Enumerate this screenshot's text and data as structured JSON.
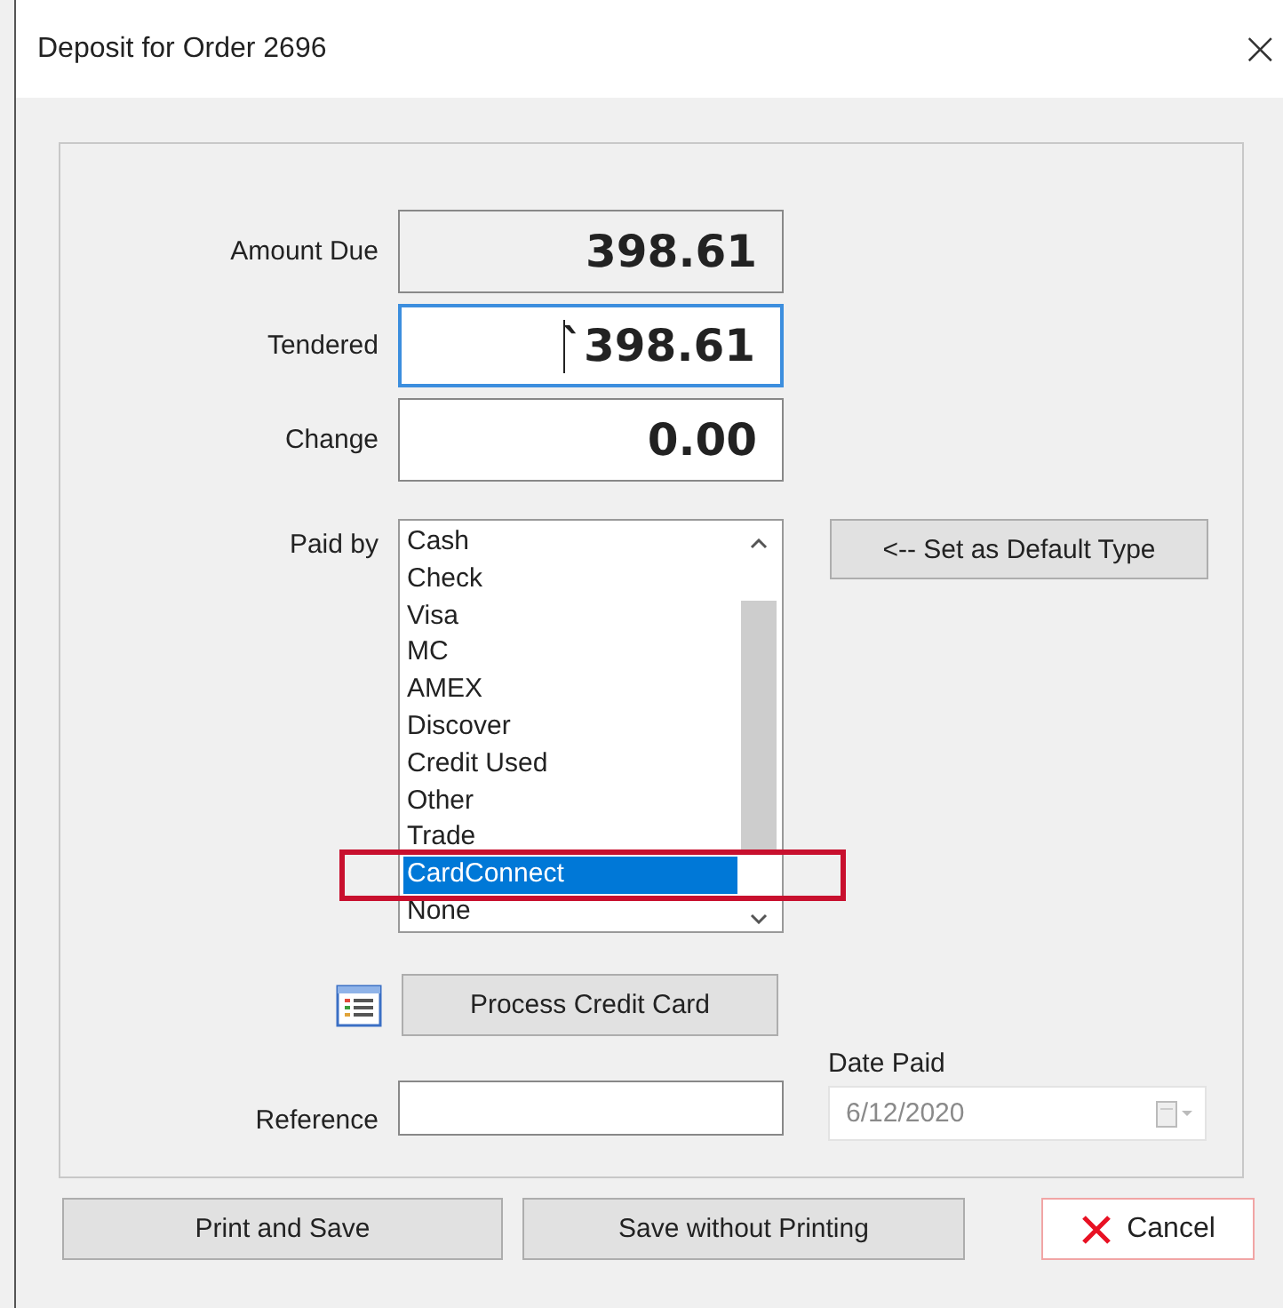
{
  "window": {
    "title": "Deposit for Order 2696",
    "close": "×"
  },
  "amount_due": {
    "label": "Amount Due",
    "value": "398.61",
    "readonly": true
  },
  "tendered": {
    "label": "Tendered",
    "value": "`398.61",
    "focused": true
  },
  "change": {
    "label": "Change",
    "value": "0.00",
    "readonly": false
  },
  "paid_by": {
    "label": "Paid by",
    "items": [
      {
        "label": "Cash",
        "selected": false,
        "outlined": false
      },
      {
        "label": "Check",
        "selected": false,
        "outlined": false
      },
      {
        "label": "Visa",
        "selected": false,
        "outlined": false
      },
      {
        "label": "MC",
        "selected": false,
        "outlined": false
      },
      {
        "label": "AMEX",
        "selected": false,
        "outlined": false
      },
      {
        "label": "Discover",
        "selected": false,
        "outlined": false
      },
      {
        "label": "Credit Used",
        "selected": false,
        "outlined": false
      },
      {
        "label": "Other",
        "selected": false,
        "outlined": false
      },
      {
        "label": "Trade",
        "selected": false,
        "outlined": false
      },
      {
        "label": "CardConnect",
        "selected": true,
        "outlined": true
      },
      {
        "label": "None",
        "selected": false,
        "outlined": false
      }
    ]
  },
  "set_default_button": "<-- Set as Default Type",
  "process_button": "Process Credit Card",
  "reference": {
    "label": "Reference"
  },
  "date_paid": {
    "label": "Date Paid",
    "value": "6/12/2020",
    "disabled": true
  },
  "buttons": [
    {
      "label": "Print and Save",
      "kind": "plain"
    },
    {
      "label": "Save without Printing",
      "kind": "plain"
    },
    {
      "label": "Cancel",
      "kind": "cancel"
    }
  ]
}
